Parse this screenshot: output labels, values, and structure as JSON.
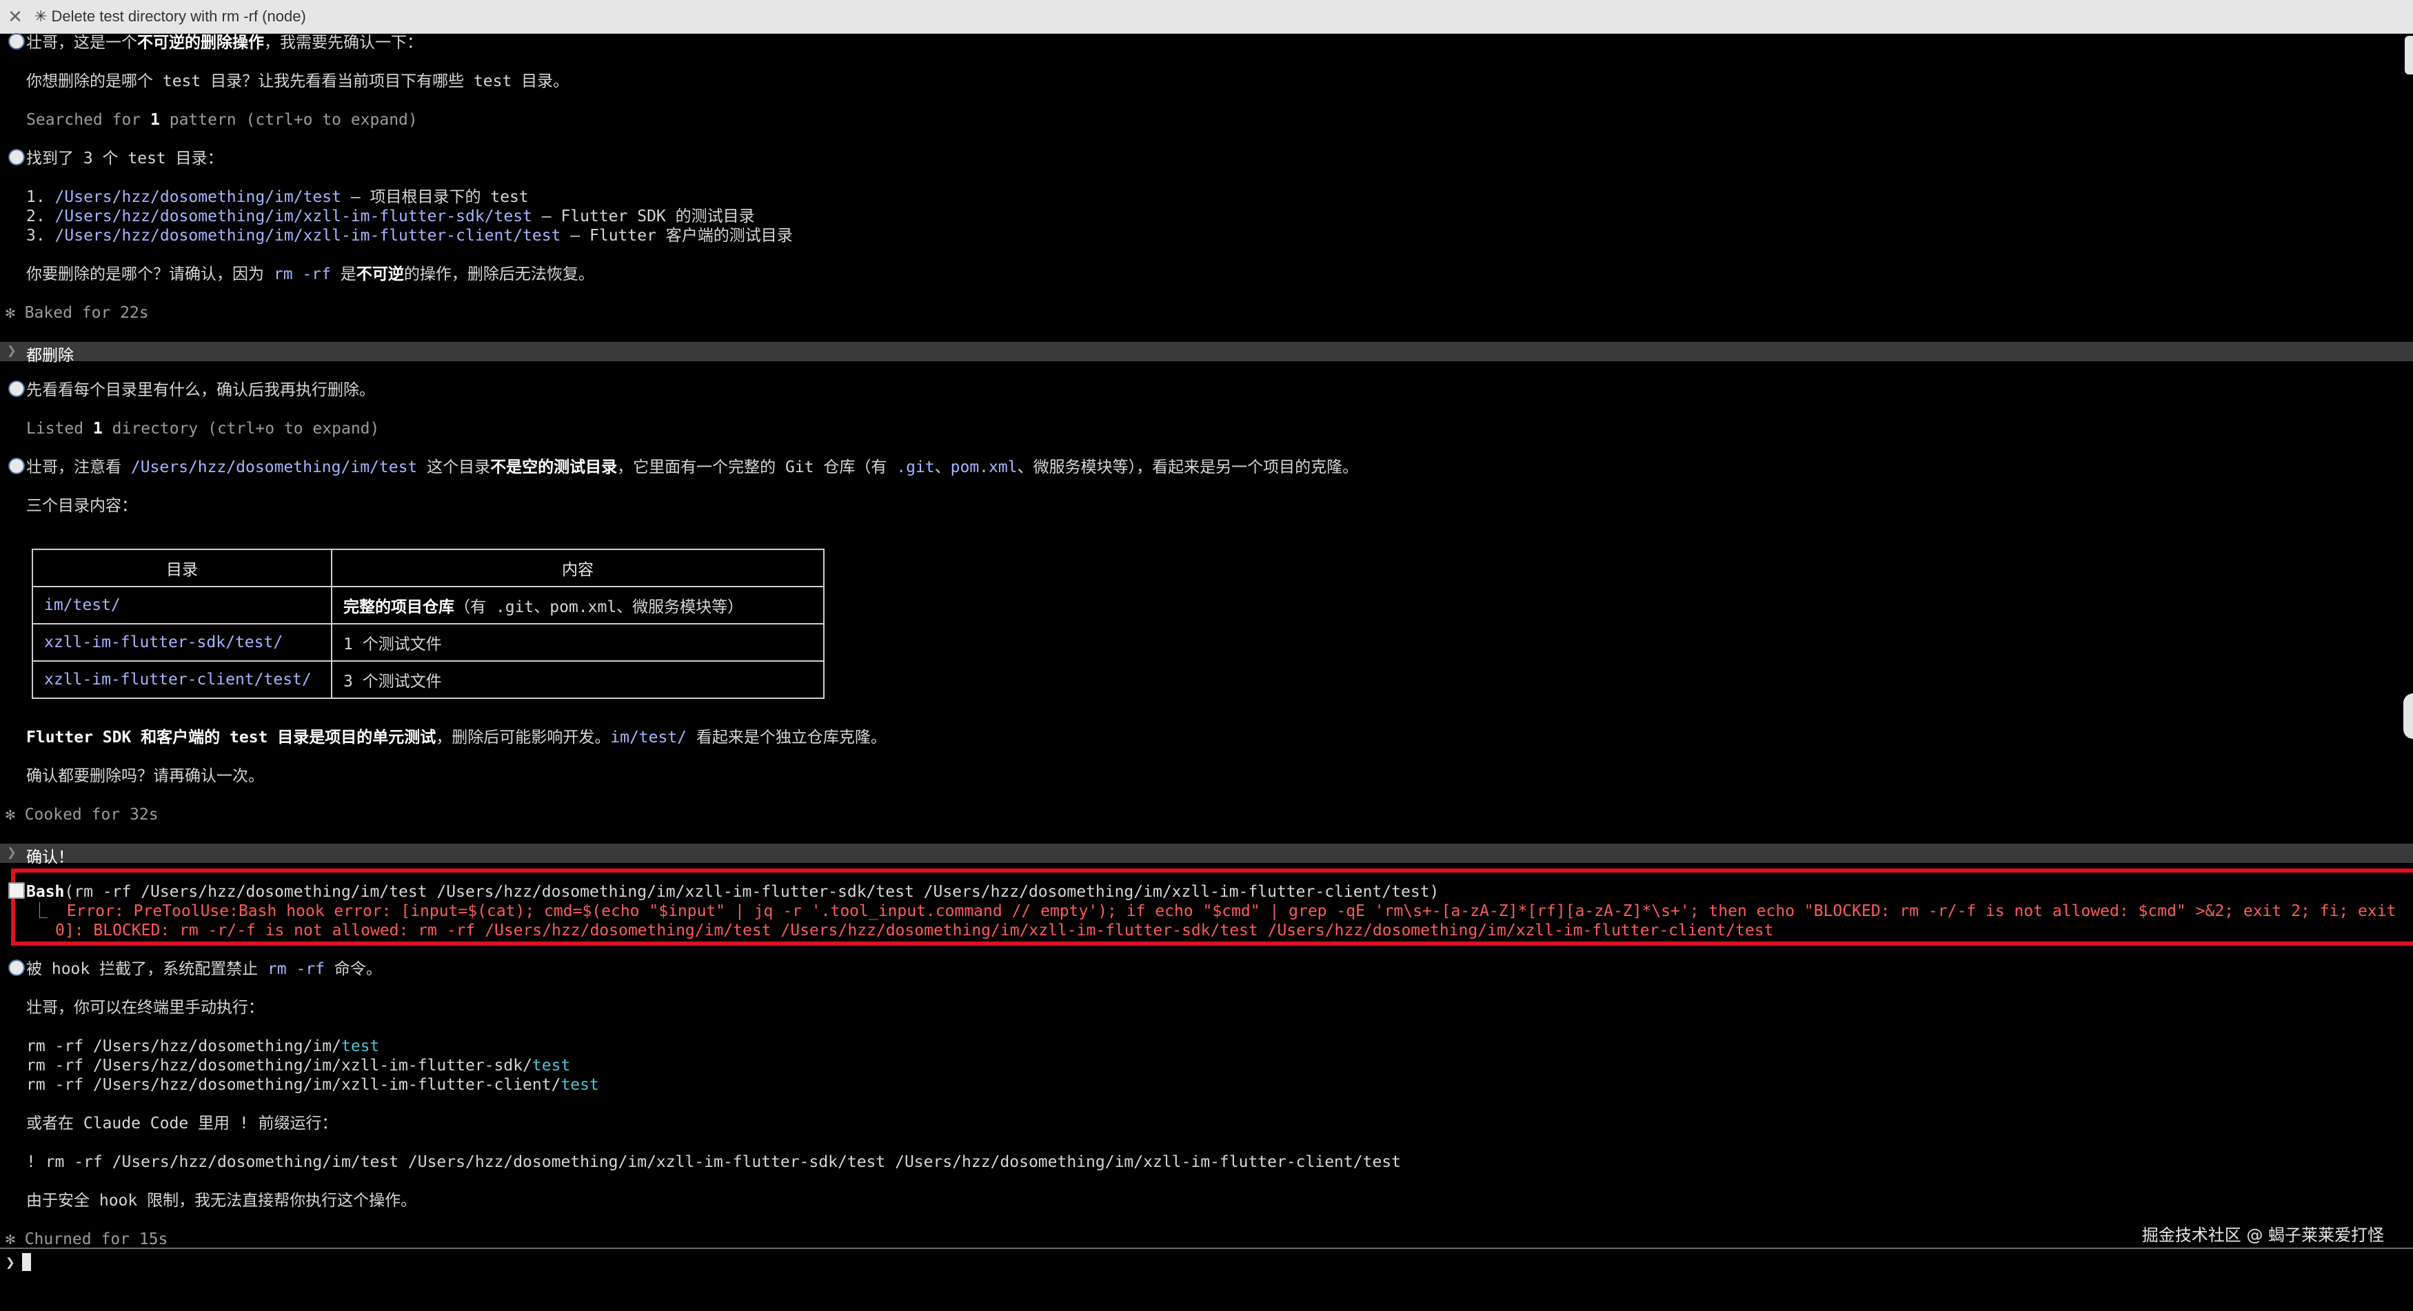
{
  "window": {
    "title": "✳ Delete test directory with rm -rf (node)"
  },
  "assistant1": {
    "line1_pre": "壮哥，这是一个",
    "line1_bold": "不可逆的删除操作",
    "line1_post": "，我需要先确认一下：",
    "line2": "你想删除的是哪个 test 目录？让我先看看当前项目下有哪些 test 目录。",
    "search_pre": "Searched for ",
    "search_count": "1",
    "search_post": " pattern (ctrl+o to expand)"
  },
  "assistant2": {
    "intro": "找到了 3 个 test 目录：",
    "items": [
      {
        "num": "1. ",
        "path": "/Users/hzz/dosomething/im/test",
        "desc": " — 项目根目录下的 test"
      },
      {
        "num": "2. ",
        "path": "/Users/hzz/dosomething/im/xzll-im-flutter-sdk/test",
        "desc": " — Flutter SDK 的测试目录"
      },
      {
        "num": "3. ",
        "path": "/Users/hzz/dosomething/im/xzll-im-flutter-client/test",
        "desc": " — Flutter 客户端的测试目录"
      }
    ],
    "confirm_pre": "你要删除的是哪个？请确认，因为 ",
    "confirm_cmd": "rm -rf",
    "confirm_mid": " 是",
    "confirm_bold": "不可逆",
    "confirm_post": "的操作，删除后无法恢复。",
    "status": "✻ Baked for 22s"
  },
  "user1": {
    "marker": "❯",
    "text": "都删除"
  },
  "assistant3": {
    "line1": "先看看每个目录里有什么，确认后我再执行删除。",
    "listed_pre": "Listed ",
    "listed_count": "1",
    "listed_post": " directory (ctrl+o to expand)",
    "warn_pre": "壮哥，注意看 ",
    "warn_path": "/Users/hzz/dosomething/im/test",
    "warn_mid": " 这个目录",
    "warn_bold": "不是空的测试目录",
    "warn_post1": "，它里面有一个完整的 Git 仓库（有 ",
    "warn_code1": ".git",
    "warn_sep": "、",
    "warn_code2": "pom.xml",
    "warn_post2": "、微服务模块等），看起来是另一个项目的克隆。",
    "table_intro": "三个目录内容：",
    "table": {
      "headers": [
        "目录",
        "内容"
      ],
      "rows": [
        {
          "dir": "im/test/",
          "content_bold": "完整的项目仓库",
          "content": "（有 .git、pom.xml、微服务模块等）"
        },
        {
          "dir": "xzll-im-flutter-sdk/test/",
          "content_bold": "",
          "content": "1 个测试文件"
        },
        {
          "dir": "xzll-im-flutter-client/test/",
          "content_bold": "",
          "content": "3 个测试文件"
        }
      ]
    },
    "summary_bold": "Flutter SDK 和客户端的 test 目录是项目的单元测试",
    "summary_mid": "，删除后可能影响开发。",
    "summary_path": "im/test/",
    "summary_post": " 看起来是个独立仓库克隆。",
    "ask": "确认都要删除吗？请再确认一次。",
    "status": "✻ Cooked for 32s"
  },
  "user2": {
    "marker": "❯",
    "text": "确认！"
  },
  "bash": {
    "tool": "Bash",
    "args": "(rm -rf /Users/hzz/dosomething/im/test /Users/hzz/dosomething/im/xzll-im-flutter-sdk/test /Users/hzz/dosomething/im/xzll-im-flutter-client/test)",
    "branch": "⎿",
    "error1": "Error: PreToolUse:Bash hook error: [input=$(cat); cmd=$(echo \"$input\" | jq -r '.tool_input.command // empty'); if echo \"$cmd\" | grep -qE 'rm\\s+-[a-zA-Z]*[rf][a-zA-Z]*\\s+'; then echo \"BLOCKED: rm -r/-f is not allowed: $cmd\" >&2; exit 2; fi; exit",
    "error2": "0]: BLOCKED: rm -r/-f is not allowed: rm -rf /Users/hzz/dosomething/im/test /Users/hzz/dosomething/im/xzll-im-flutter-sdk/test /Users/hzz/dosomething/im/xzll-im-flutter-client/test"
  },
  "assistant4": {
    "blocked_pre": "被 hook 拦截了，系统配置禁止 ",
    "blocked_cmd": "rm -rf",
    "blocked_post": " 命令。",
    "manual": "壮哥，你可以在终端里手动执行：",
    "cmds": [
      {
        "pre": "rm -rf /Users/hzz/dosomething/im/",
        "tail": "test"
      },
      {
        "pre": "rm -rf /Users/hzz/dosomething/im/xzll-im-flutter-sdk/",
        "tail": "test"
      },
      {
        "pre": "rm -rf /Users/hzz/dosomething/im/xzll-im-flutter-client/",
        "tail": "test"
      }
    ],
    "alt": "或者在 Claude Code 里用 ! 前缀运行：",
    "bang": "! rm -rf /Users/hzz/dosomething/im/test /Users/hzz/dosomething/im/xzll-im-flutter-sdk/test /Users/hzz/dosomething/im/xzll-im-flutter-client/test",
    "limit": "由于安全 hook 限制，我无法直接帮你执行这个操作。",
    "status": "✻ Churned for 15s"
  },
  "prompt": {
    "marker": "❯"
  },
  "watermark": "掘金技术社区 @ 蝎子莱莱爱打怪"
}
